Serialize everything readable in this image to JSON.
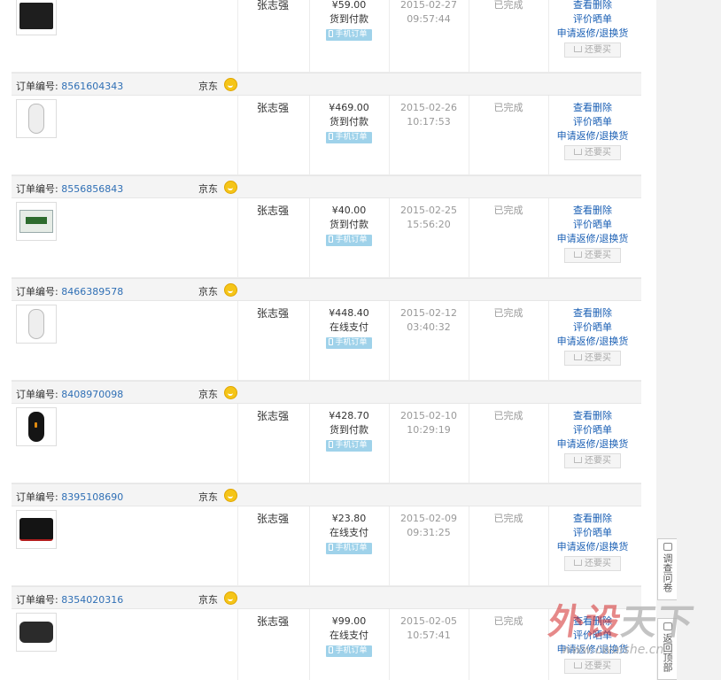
{
  "columns_note": "",
  "brand_tag": "手机订单",
  "rebuy_label": "还要买",
  "buyer": "张志强",
  "status": "已完成",
  "actions": {
    "view": "查看",
    "delete": "删除",
    "review": "评价晒单",
    "repair": "申请返修/退换货"
  },
  "shop_name": "京东",
  "order_no_label": "订单编号:",
  "orders": [
    {
      "order_no": "",
      "product_icon": "mousepad-black",
      "price": "¥59.00",
      "payment": "货到付款",
      "date": "2015-02-27",
      "time": "09:57:44"
    },
    {
      "order_no": "8561604343",
      "product_icon": "mouse-white",
      "price": "¥469.00",
      "payment": "货到付款",
      "date": "2015-02-26",
      "time": "10:17:53"
    },
    {
      "order_no": "8556856843",
      "product_icon": "boxed-product",
      "price": "¥40.00",
      "payment": "货到付款",
      "date": "2015-02-25",
      "time": "15:56:20"
    },
    {
      "order_no": "8466389578",
      "product_icon": "mouse-white",
      "price": "¥448.40",
      "payment": "在线支付",
      "date": "2015-02-12",
      "time": "03:40:32"
    },
    {
      "order_no": "8408970098",
      "product_icon": "mouse-black",
      "price": "¥428.70",
      "payment": "货到付款",
      "date": "2015-02-10",
      "time": "10:29:19"
    },
    {
      "order_no": "8395108690",
      "product_icon": "mousepad-red",
      "price": "¥23.80",
      "payment": "在线支付",
      "date": "2015-02-09",
      "time": "09:31:25"
    },
    {
      "order_no": "8354020316",
      "product_icon": "mousepad-dark",
      "price": "¥99.00",
      "payment": "在线支付",
      "date": "2015-02-05",
      "time": "10:57:41"
    }
  ],
  "side": {
    "survey": "调查问卷",
    "backtop": "返回顶部"
  },
  "watermark": {
    "main_a": "外设",
    "main_b": "天下",
    "url": "www.cwaishe.cn"
  },
  "colors": {
    "link": "#1a5fb4",
    "order_no": "#2f6fb5",
    "badge": "#9fd2ea",
    "jd_icon": "#f5c518"
  }
}
